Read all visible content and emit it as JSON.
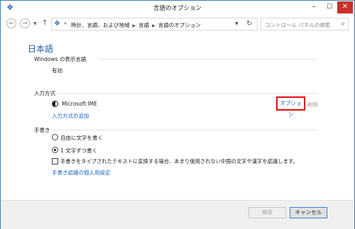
{
  "window": {
    "title": "言語のオプション"
  },
  "nav": {
    "back_icon": "back-arrow-icon",
    "forward_icon": "forward-arrow-icon",
    "up_icon": "up-arrow-icon"
  },
  "address": {
    "prefix": "«",
    "crumbs": [
      "時計、言語、および地域",
      "言語",
      "言語のオプション"
    ]
  },
  "search": {
    "placeholder": "コントロール パネルの検索"
  },
  "main": {
    "heading": "日本語",
    "windows_display_language": {
      "title": "Windows の表示言語",
      "value": "有効"
    },
    "input_method": {
      "title": "入力方式",
      "ime_name": "Microsoft IME",
      "options_label": "オプション",
      "delete_label": "削除",
      "add_label": "入力方式の追加"
    },
    "handwriting": {
      "title": "手書き",
      "radio_freeform": "自由に文字を書く",
      "radio_one_char": "1 文字ずつ書く",
      "radio_selected": "1 文字ずつ書く",
      "checkbox_label": "手書きをタイプされたテキストに変換する場合、あまり使用されない中国の文字や漢字を認識します。",
      "checkbox_checked": false,
      "personalize_label": "手書き認識の個人用設定"
    }
  },
  "footer": {
    "save_label": "保存",
    "cancel_label": "キャンセル"
  },
  "colors": {
    "accent": "#1e69c0",
    "heading": "#1e5aa8",
    "highlight": "#e01010",
    "close_button": "#c7312c"
  }
}
